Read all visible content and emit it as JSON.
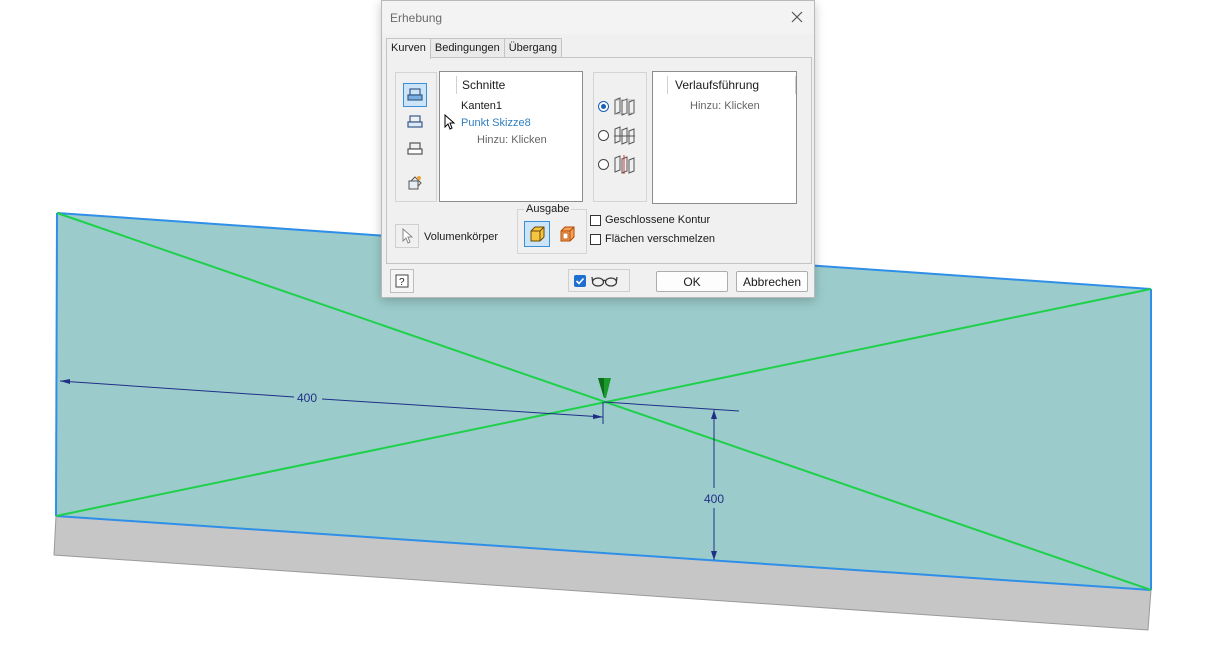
{
  "dialog": {
    "title": "Erhebung",
    "tabs": [
      {
        "label": "Kurven",
        "active": true
      },
      {
        "label": "Bedingungen",
        "active": false
      },
      {
        "label": "Übergang",
        "active": false
      }
    ],
    "sections": {
      "header": "Schnitte",
      "items": [
        {
          "label": "Kanten1",
          "color": "#1a1a1a"
        },
        {
          "label": "Punkt Skizze8",
          "color": "#2f7fbf"
        },
        {
          "label": "Hinzu: Klicken",
          "color": "#666666"
        }
      ]
    },
    "rails": {
      "header": "Verlaufsführung",
      "add_label": "Hinzu: Klicken"
    },
    "loft_type_radios": [
      {
        "icon": "rails-loft-icon",
        "checked": true
      },
      {
        "icon": "centerline-loft-icon",
        "checked": false
      },
      {
        "icon": "area-loft-icon",
        "checked": false
      }
    ],
    "toolbar_icons": [
      "sketch-curves-icon",
      "sketch-curves-2-icon",
      "sketch-curves-3-icon",
      "point-icon"
    ],
    "volume_label": "Volumenkörper",
    "output_label": "Ausgabe",
    "checkboxes": {
      "closed_loop": {
        "label": "Geschlossene Kontur",
        "checked": false
      },
      "merge_faces": {
        "label": "Flächen verschmelzen",
        "checked": false
      }
    },
    "preview_checked": true,
    "ok_label": "OK",
    "cancel_label": "Abbrechen"
  },
  "viewport": {
    "dimensions": [
      "400",
      "400"
    ],
    "colors": {
      "face": "#9bcccb",
      "edge": "#2f8fe8",
      "diagonal": "#1ed04a",
      "dimension": "#1f2f86",
      "base": "#c6c6c6",
      "marker": "#1a9a2a"
    }
  }
}
